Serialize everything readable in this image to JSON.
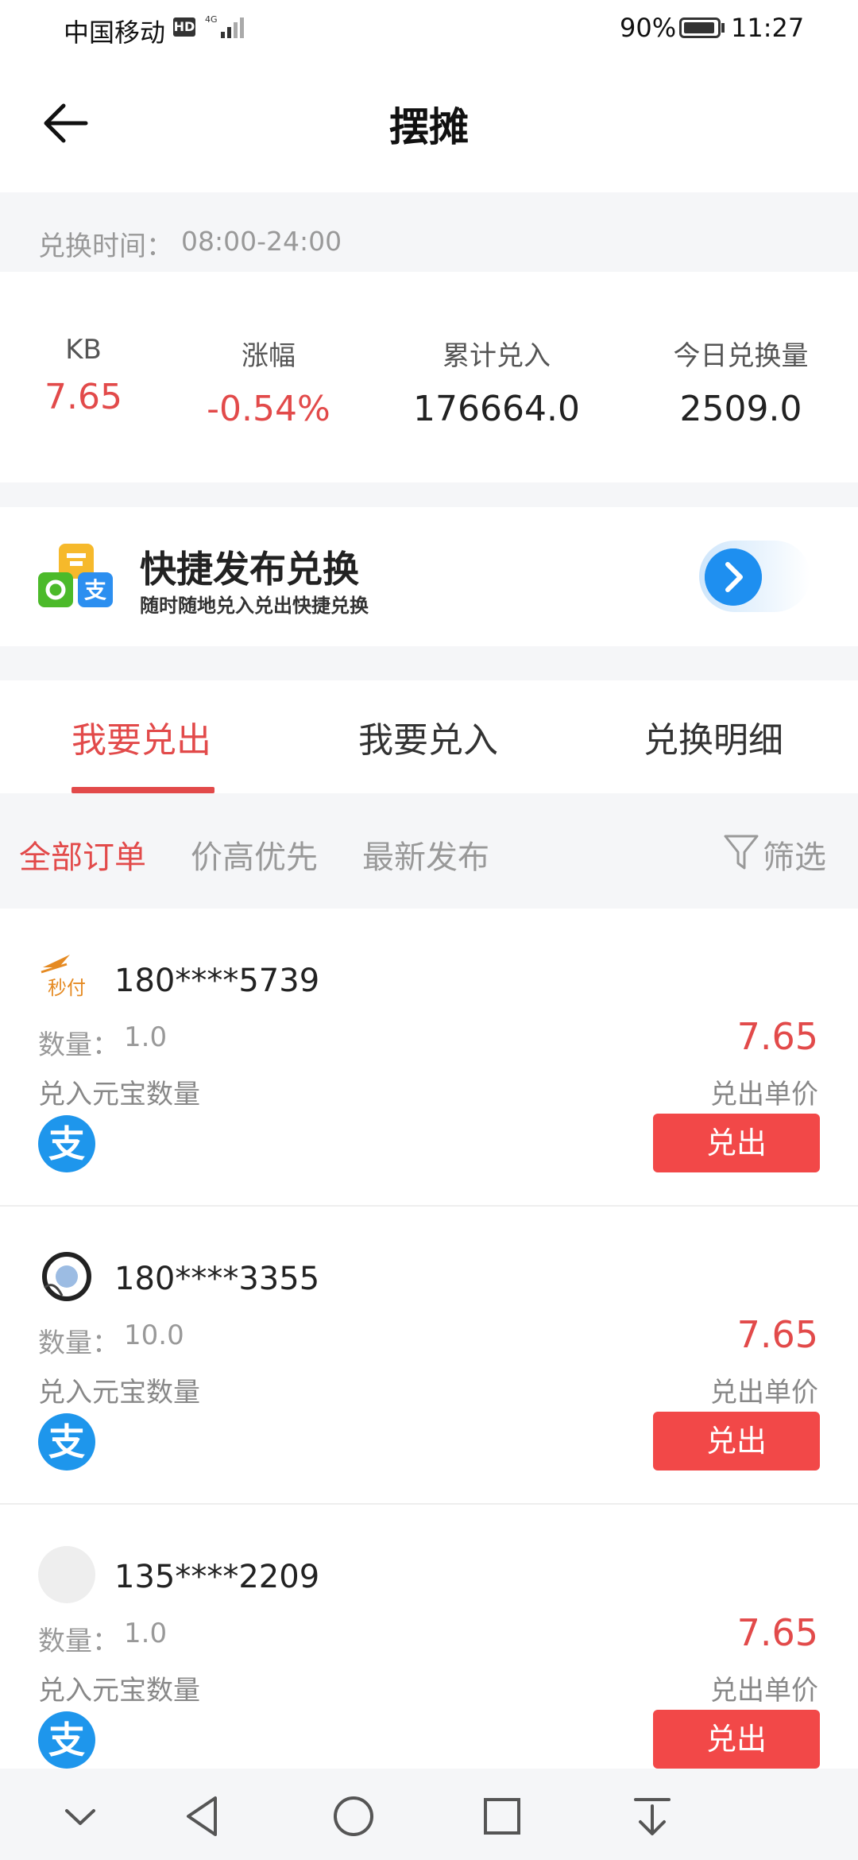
{
  "status_bar": {
    "carrier": "中国移动",
    "hd": "HD",
    "battery": "90%",
    "time": "11:27"
  },
  "header": {
    "title": "摆摊"
  },
  "exchange_time": {
    "label": "兑换时间：",
    "value": "08:00-24:00"
  },
  "stats": [
    {
      "label": "KB",
      "value": "7.65"
    },
    {
      "label": "涨幅",
      "value": "-0.54%"
    },
    {
      "label": "累计兑入",
      "value": "176664.0"
    },
    {
      "label": "今日兑换量",
      "value": "2509.0"
    }
  ],
  "banner": {
    "title": "快捷发布兑换",
    "subtitle": "随时随地兑入兑出快捷兑换"
  },
  "tabs": [
    {
      "label": "我要兑出"
    },
    {
      "label": "我要兑入"
    },
    {
      "label": "兑换明细"
    }
  ],
  "filters": {
    "items": [
      "全部订单",
      "价高优先",
      "最新发布"
    ],
    "filter_label": "筛选"
  },
  "orders": [
    {
      "avatar_text": "秒付",
      "phone": "180****5739",
      "qty_label": "数量：",
      "qty": "1.0",
      "yb_label": "兑入元宝数量",
      "pay_icon": "支",
      "price": "7.65",
      "price_label": "兑出单价",
      "button": "兑出"
    },
    {
      "avatar_text": "",
      "phone": "180****3355",
      "qty_label": "数量：",
      "qty": "10.0",
      "yb_label": "兑入元宝数量",
      "pay_icon": "支",
      "price": "7.65",
      "price_label": "兑出单价",
      "button": "兑出"
    },
    {
      "avatar_text": "",
      "phone": "135****2209",
      "qty_label": "数量：",
      "qty": "1.0",
      "yb_label": "兑入元宝数量",
      "pay_icon": "支",
      "price": "7.65",
      "price_label": "兑出单价",
      "button": "兑出"
    }
  ],
  "colors": {
    "accent_red": "#e24a4a",
    "button_red": "#f24848",
    "alipay_blue": "#1e96ec"
  }
}
